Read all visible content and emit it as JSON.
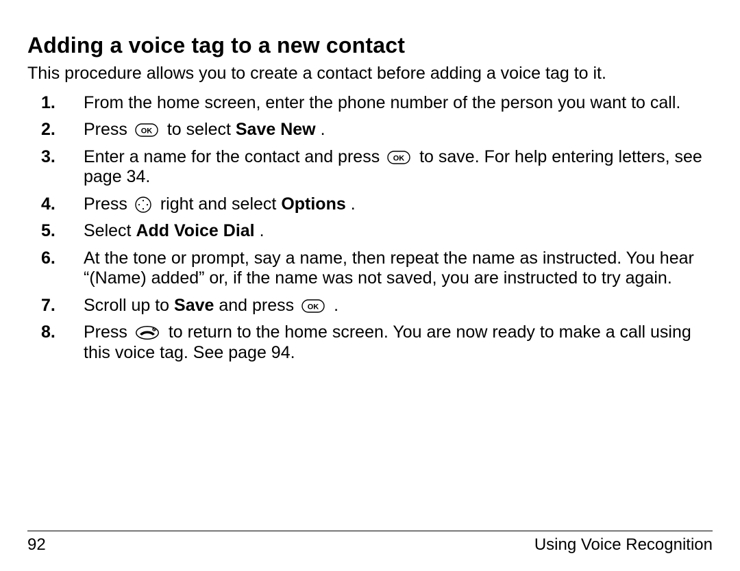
{
  "title": "Adding a voice tag to a new contact",
  "intro": "This procedure allows you to create a contact before adding a voice tag to it.",
  "steps": [
    {
      "n": "1.",
      "a": "From the home screen, enter the phone number of the person you want to call."
    },
    {
      "n": "2.",
      "a": "Press ",
      "icon": "ok",
      "b": " to select ",
      "bold1": "Save New",
      "c": "."
    },
    {
      "n": "3.",
      "a": "Enter a name for the contact and press ",
      "icon": "ok",
      "b": " to save. For help entering letters, see page 34."
    },
    {
      "n": "4.",
      "a": "Press ",
      "icon": "nav",
      "b": " right and select ",
      "bold1": "Options",
      "c": "."
    },
    {
      "n": "5.",
      "a": "Select ",
      "bold1": "Add Voice Dial",
      "c": "."
    },
    {
      "n": "6.",
      "a": "At the tone or prompt, say a name, then repeat the name as instructed. You hear “(Name) added” or, if the name was not saved, you are instructed to try again."
    },
    {
      "n": "7.",
      "a": "Scroll up to ",
      "bold1": "Save",
      "b": " and press ",
      "icon": "ok",
      "c": "."
    },
    {
      "n": "8.",
      "a": "Press ",
      "icon": "end",
      "b": " to return to the home screen. You are now ready to make a call using this voice tag. See page 94."
    }
  ],
  "footer": {
    "page": "92",
    "section": "Using Voice Recognition"
  }
}
